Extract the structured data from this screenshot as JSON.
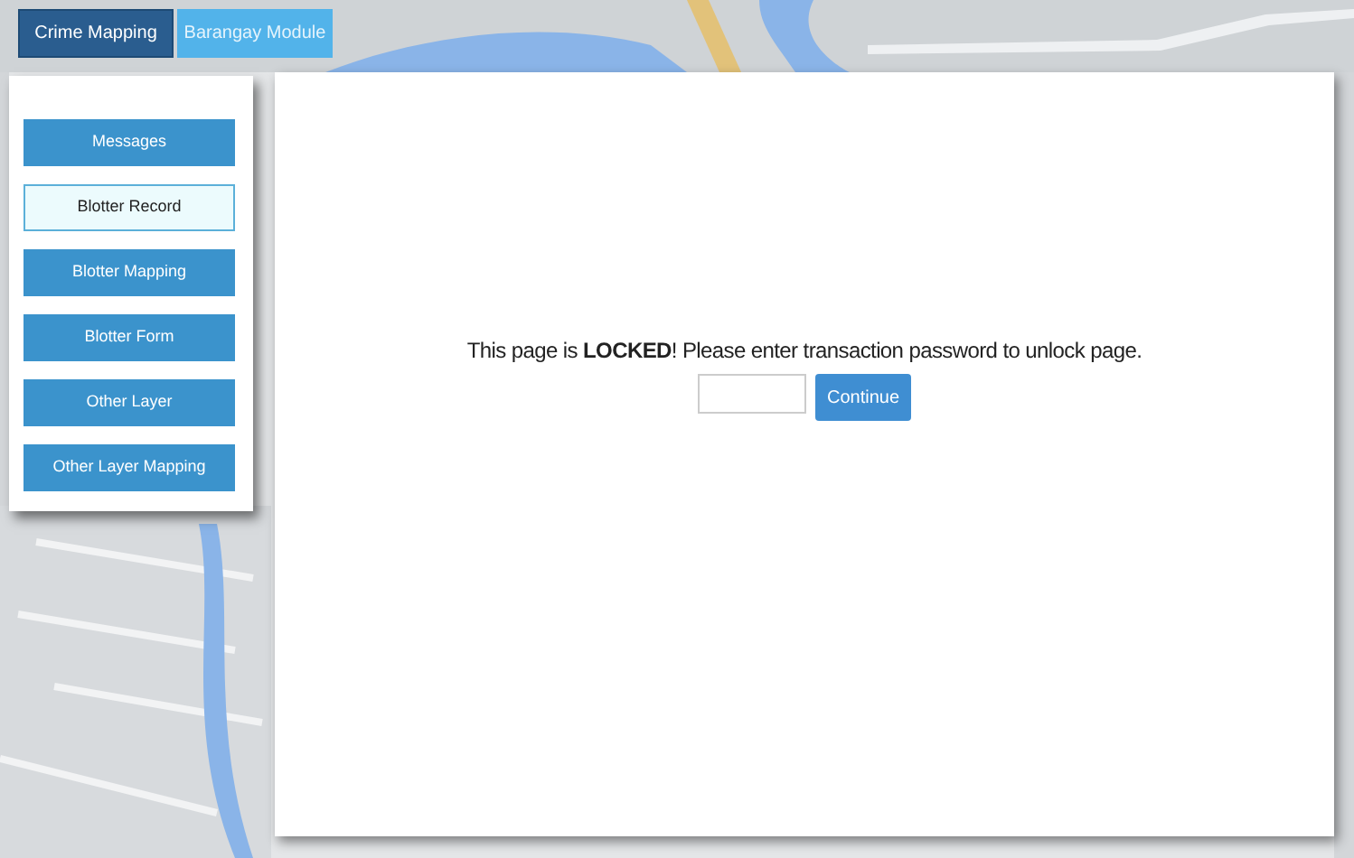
{
  "tabs": [
    {
      "label": "Crime Mapping",
      "selected": true
    },
    {
      "label": "Barangay Module",
      "selected": false
    }
  ],
  "sidebar": {
    "items": [
      {
        "label": "Messages",
        "selected": false
      },
      {
        "label": "Blotter Record",
        "selected": true
      },
      {
        "label": "Blotter Mapping",
        "selected": false
      },
      {
        "label": "Blotter Form",
        "selected": false
      },
      {
        "label": "Other Layer",
        "selected": false
      },
      {
        "label": "Other Layer Mapping",
        "selected": false
      }
    ]
  },
  "lock_notice": {
    "message": "This page is **LOCKED**! Please enter transaction password to unlock page.",
    "button": "Continue"
  }
}
